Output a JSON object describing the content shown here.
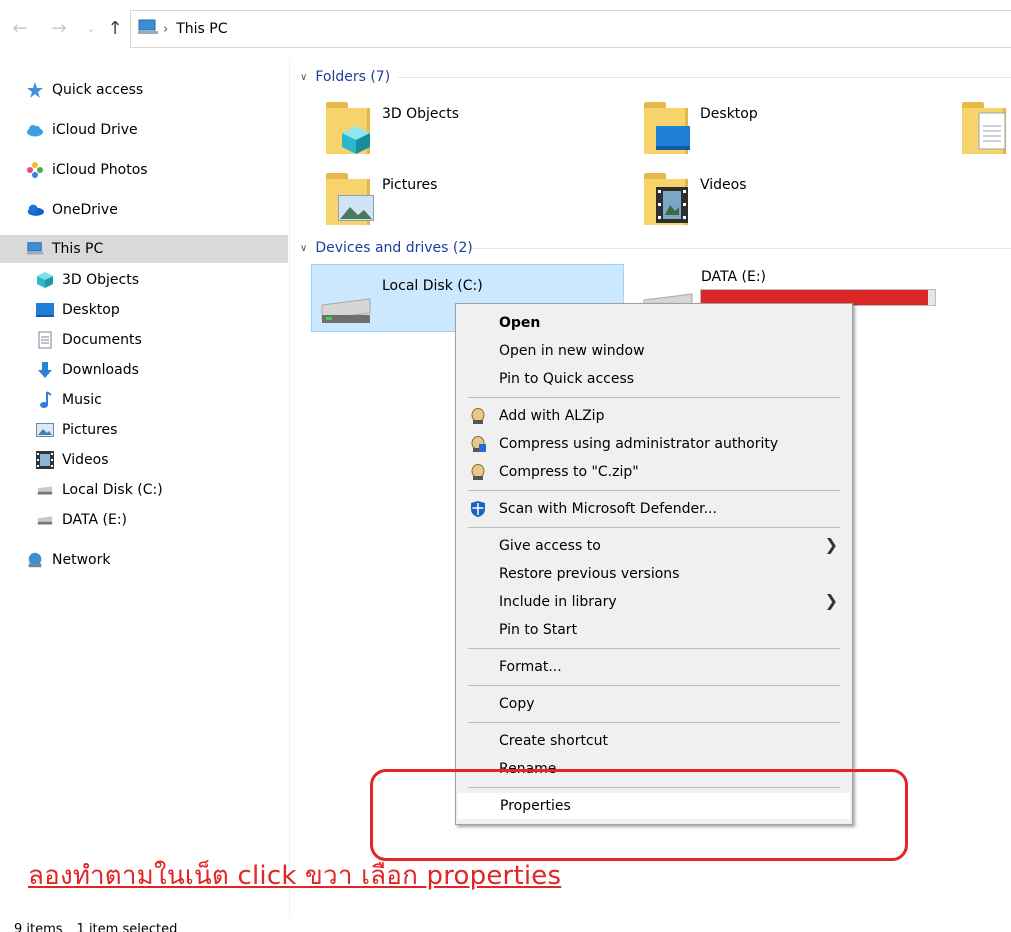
{
  "address": {
    "path": [
      "This PC"
    ]
  },
  "nav": {
    "items": [
      {
        "label": "Quick access",
        "icon": "star-icon"
      },
      {
        "label": "iCloud Drive",
        "icon": "icloud-icon"
      },
      {
        "label": "iCloud Photos",
        "icon": "photos-icon"
      },
      {
        "label": "OneDrive",
        "icon": "onedrive-icon"
      },
      {
        "label": "This PC",
        "icon": "computer-icon",
        "selected": true
      },
      {
        "label": "3D Objects",
        "icon": "cube-icon"
      },
      {
        "label": "Desktop",
        "icon": "desktop-icon"
      },
      {
        "label": "Documents",
        "icon": "document-icon"
      },
      {
        "label": "Downloads",
        "icon": "download-icon"
      },
      {
        "label": "Music",
        "icon": "music-icon"
      },
      {
        "label": "Pictures",
        "icon": "picture-icon"
      },
      {
        "label": "Videos",
        "icon": "video-icon"
      },
      {
        "label": "Local Disk (C:)",
        "icon": "drive-icon"
      },
      {
        "label": "DATA (E:)",
        "icon": "drive-icon"
      },
      {
        "label": "Network",
        "icon": "network-icon"
      }
    ]
  },
  "content": {
    "folders_header": "Folders (7)",
    "folders": [
      "3D Objects",
      "Desktop",
      "Pictures",
      "Videos"
    ],
    "devices_header": "Devices and drives (2)",
    "drives": [
      {
        "label": "Local Disk (C:)",
        "selected": true
      },
      {
        "label": "DATA (E:)",
        "used_fraction": 0.97
      }
    ]
  },
  "context_menu": {
    "items": [
      "Open",
      "Open in new window",
      "Pin to Quick access",
      "Add with ALZip",
      "Compress using administrator authority",
      "Compress to \"C.zip\"",
      "Scan with Microsoft Defender...",
      "Give access to",
      "Restore previous versions",
      "Include in library",
      "Pin to Start",
      "Format...",
      "Copy",
      "Create shortcut",
      "Rename",
      "Properties"
    ]
  },
  "annotation": "ลองทำตามในเน็ต click ขวา เลือก properties",
  "status": {
    "items_count": "9 items",
    "selected": "1 item selected"
  },
  "colors": {
    "accent": "#1e3f9c",
    "selection": "#cce8ff",
    "annotation": "#e02626",
    "capacity_full": "#da2626"
  }
}
